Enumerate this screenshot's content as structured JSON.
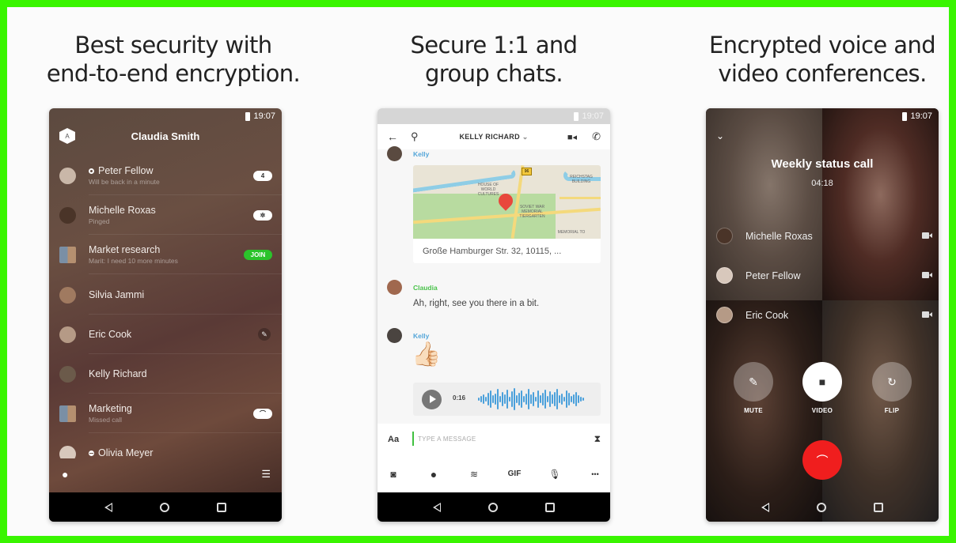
{
  "panels": [
    {
      "headline": [
        "Best security with",
        "end-to-end encryption."
      ],
      "phone": {
        "time": "19:07",
        "account_initial": "A",
        "title": "Claudia Smith",
        "conversations": [
          {
            "name": "Peter Fellow",
            "subtitle": "Will be back in a minute",
            "status": "away",
            "badge": "4",
            "badge_type": "count"
          },
          {
            "name": "Michelle Roxas",
            "subtitle": "Pinged",
            "status": "",
            "badge": "ping",
            "badge_type": "ping"
          },
          {
            "name": "Market research",
            "subtitle": "Marit: I need 10 more minutes",
            "status": "",
            "badge": "JOIN",
            "badge_type": "join"
          },
          {
            "name": "Silvia Jammi",
            "subtitle": "",
            "status": "",
            "badge": "",
            "badge_type": ""
          },
          {
            "name": "Eric Cook",
            "subtitle": "",
            "status": "",
            "badge": "muted",
            "badge_type": "muted"
          },
          {
            "name": "Kelly Richard",
            "subtitle": "",
            "status": "",
            "badge": "",
            "badge_type": ""
          },
          {
            "name": "Marketing",
            "subtitle": "Missed call",
            "status": "",
            "badge": "missed-call",
            "badge_type": "call"
          },
          {
            "name": "Olivia Meyer",
            "subtitle": "",
            "status": "busy",
            "badge": "",
            "badge_type": ""
          }
        ],
        "bottom_left_icon": "person-icon",
        "bottom_right_icon": "archive-icon"
      }
    },
    {
      "headline": [
        "Secure 1:1 and",
        "group chats."
      ],
      "phone": {
        "time": "19:07",
        "chat_title": "KELLY RICHARD",
        "messages": [
          {
            "sender": "Kelly",
            "sender_color": "#54a6d9",
            "type": "location",
            "address": "Große Hamburger Str. 32, 10115, ...",
            "map_labels": [
              "HOUSE OF WORLD CULTURES",
              "SOVIET WAR MEMORIAL TIERGARTEN",
              "REICHSTAG BUILDING",
              "MEMORIAL TO",
              "96"
            ]
          },
          {
            "sender": "Claudia",
            "sender_color": "#49c24a",
            "type": "text",
            "text": "Ah, right, see you there in a bit."
          },
          {
            "sender": "Kelly",
            "sender_color": "#54a6d9",
            "type": "emoji",
            "text": "👍🏻"
          },
          {
            "sender": "Kelly",
            "type": "voice",
            "duration": "0:16"
          }
        ],
        "composer": {
          "format_label": "Aa",
          "placeholder": "TYPE A MESSAGE"
        },
        "toolbar": [
          "camera-icon",
          "ping-icon",
          "sketch-icon",
          "GIF",
          "mic-icon",
          "more-icon"
        ],
        "gif_label": "GIF",
        "more_label": "•••"
      }
    },
    {
      "headline": [
        "Encrypted voice and",
        "video conferences."
      ],
      "phone": {
        "time": "19:07",
        "call_title": "Weekly status call",
        "call_duration": "04:18",
        "participants": [
          {
            "name": "Michelle Roxas"
          },
          {
            "name": "Peter Fellow"
          },
          {
            "name": "Eric Cook"
          }
        ],
        "controls": [
          {
            "label": "MUTE",
            "icon": "mic-off-icon",
            "active": false
          },
          {
            "label": "VIDEO",
            "icon": "video-icon",
            "active": true
          },
          {
            "label": "FLIP",
            "icon": "flip-camera-icon",
            "active": false
          }
        ],
        "end_call_color": "#f01e1e"
      }
    }
  ],
  "colors": {
    "border": "#39f500",
    "join": "#2bc32b",
    "accent_green": "#49c24a",
    "accent_blue": "#54a6d9",
    "wave": "#4aa0db"
  }
}
